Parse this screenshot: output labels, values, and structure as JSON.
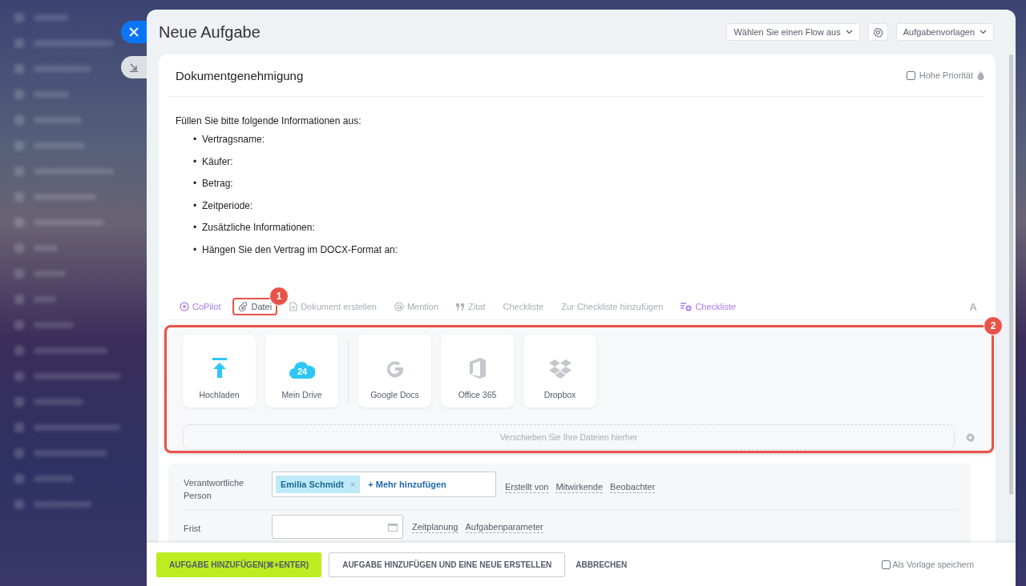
{
  "header": {
    "title": "Neue Aufgabe",
    "flow_select": "Wählen Sie einen Flow aus",
    "templates": "Aufgabenvorlagen"
  },
  "task": {
    "title": "Dokumentgenehmigung",
    "high_priority": {
      "label": "Hohe Priorität",
      "checked": false
    }
  },
  "description": {
    "intro": "Füllen Sie bitte folgende Informationen aus:",
    "items": [
      {
        "marker": "•",
        "text": "Vertragsname:"
      },
      {
        "marker": "•",
        "text": "Käufer:"
      },
      {
        "marker": "•",
        "text": "Betrag:"
      },
      {
        "marker": "•",
        "text": "Zeitperiode:"
      },
      {
        "marker": "•",
        "text": "Zusätzliche Informationen:"
      },
      {
        "marker": "•",
        "text": "Hängen Sie den Vertrag im DOCX-Format an:"
      }
    ]
  },
  "toolbar": [
    {
      "label": "CoPilot",
      "kind": "copilot",
      "selected": false
    },
    {
      "label": "Datei",
      "kind": "file",
      "selected": true,
      "callout": "1"
    },
    {
      "label": "Dokument erstellen",
      "kind": "document",
      "selected": false
    },
    {
      "label": "Mention",
      "kind": "mention",
      "selected": false
    },
    {
      "label": "Zitat",
      "kind": "quote",
      "selected": false
    },
    {
      "label": "Checkliste",
      "kind": "plain",
      "selected": false
    },
    {
      "label": "Zur Checkliste hinzufügen",
      "kind": "plain",
      "selected": false
    },
    {
      "label": "Checkliste",
      "kind": "checklist",
      "selected": false
    }
  ],
  "format_button": "A",
  "attach": {
    "callout": "2",
    "sources": [
      {
        "label": "Hochladen",
        "kind": "upload"
      },
      {
        "label": "Mein Drive",
        "kind": "drive",
        "badge": "24"
      },
      {
        "label": "Google Docs",
        "kind": "google"
      },
      {
        "label": "Office 365",
        "kind": "office"
      },
      {
        "label": "Dropbox",
        "kind": "dropbox"
      }
    ],
    "drop_hint": "Verschieben Sie Ihre Dateien hierher"
  },
  "fields": [
    {
      "label": "Verantwortliche Person",
      "kind": "people",
      "tags": [
        {
          "name": "Emilia Schmidt",
          "remove": "×"
        }
      ],
      "add": "+ Mehr hinzufügen",
      "links": [
        "Erstellt von",
        "Mitwirkende",
        "Beobachter"
      ]
    },
    {
      "label": "Frist",
      "kind": "date",
      "links": [
        "Zeitplanung",
        "Aufgabenparameter"
      ]
    }
  ],
  "footer": {
    "primary": "AUFGABE HINZUFÜGEN(⌘+ENTER)",
    "secondary": "AUFGABE HINZUFÜGEN UND EINE NEUE ERSTELLEN",
    "cancel": "ABBRECHEN",
    "save_template": {
      "label": "Als Vorlage speichern",
      "checked": false
    }
  }
}
